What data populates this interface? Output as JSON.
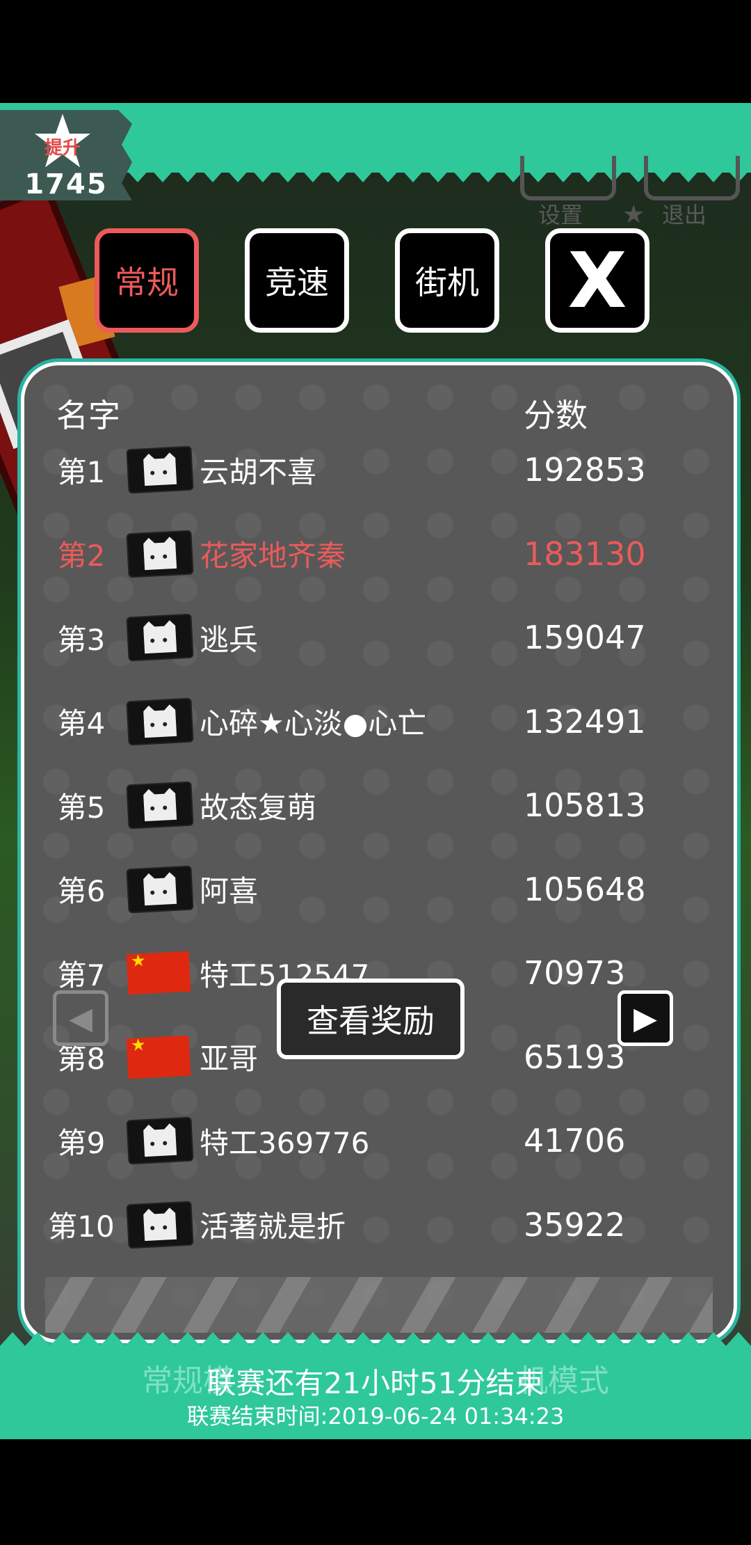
{
  "promotion": {
    "label": "提升",
    "value": "1745"
  },
  "top_controls": {
    "settings_label": "设置",
    "exit_label": "退出"
  },
  "tabs": [
    {
      "label": "常规",
      "active": true
    },
    {
      "label": "竞速",
      "active": false
    },
    {
      "label": "街机",
      "active": false
    },
    {
      "label": "X",
      "active": false
    }
  ],
  "leaderboard": {
    "header_name": "名字",
    "header_score": "分数",
    "rows": [
      {
        "rank": "第1",
        "avatar": "cat-avatar-icon",
        "name": "云胡不喜",
        "score": "192853"
      },
      {
        "rank": "第2",
        "avatar": "cat-avatar-icon",
        "name": "花家地齐秦",
        "score": "183130",
        "highlight": true
      },
      {
        "rank": "第3",
        "avatar": "cat-avatar-icon",
        "name": "逃兵",
        "score": "159047"
      },
      {
        "rank": "第4",
        "avatar": "cat-avatar-icon",
        "name": "心碎★心淡●心亡",
        "score": "132491"
      },
      {
        "rank": "第5",
        "avatar": "cat-avatar-icon",
        "name": "故态复萌",
        "score": "105813"
      },
      {
        "rank": "第6",
        "avatar": "cat-avatar-icon",
        "name": "阿喜",
        "score": "105648"
      },
      {
        "rank": "第7",
        "avatar": "china-flag-icon",
        "name": "特工512547",
        "score": "70973"
      },
      {
        "rank": "第8",
        "avatar": "china-flag-icon",
        "name": "亚哥",
        "score": "65193"
      },
      {
        "rank": "第9",
        "avatar": "cat-avatar-icon",
        "name": "特工369776",
        "score": "41706"
      },
      {
        "rank": "第10",
        "avatar": "cat-avatar-icon",
        "name": "活著就是折",
        "score": "35922"
      }
    ],
    "reward_button": "查看奖励",
    "prev_icon": "left-arrow-icon",
    "next_icon": "right-arrow-icon"
  },
  "background_modes": {
    "left": "常规模",
    "right": "机模式"
  },
  "league": {
    "countdown": "联赛还有21小时51分结束",
    "end_time": "联赛结束时间:2019-06-24 01:34:23"
  },
  "colors": {
    "accent_green": "#2ec89b",
    "highlight_red": "#ec5a5a",
    "panel": "#585858"
  }
}
